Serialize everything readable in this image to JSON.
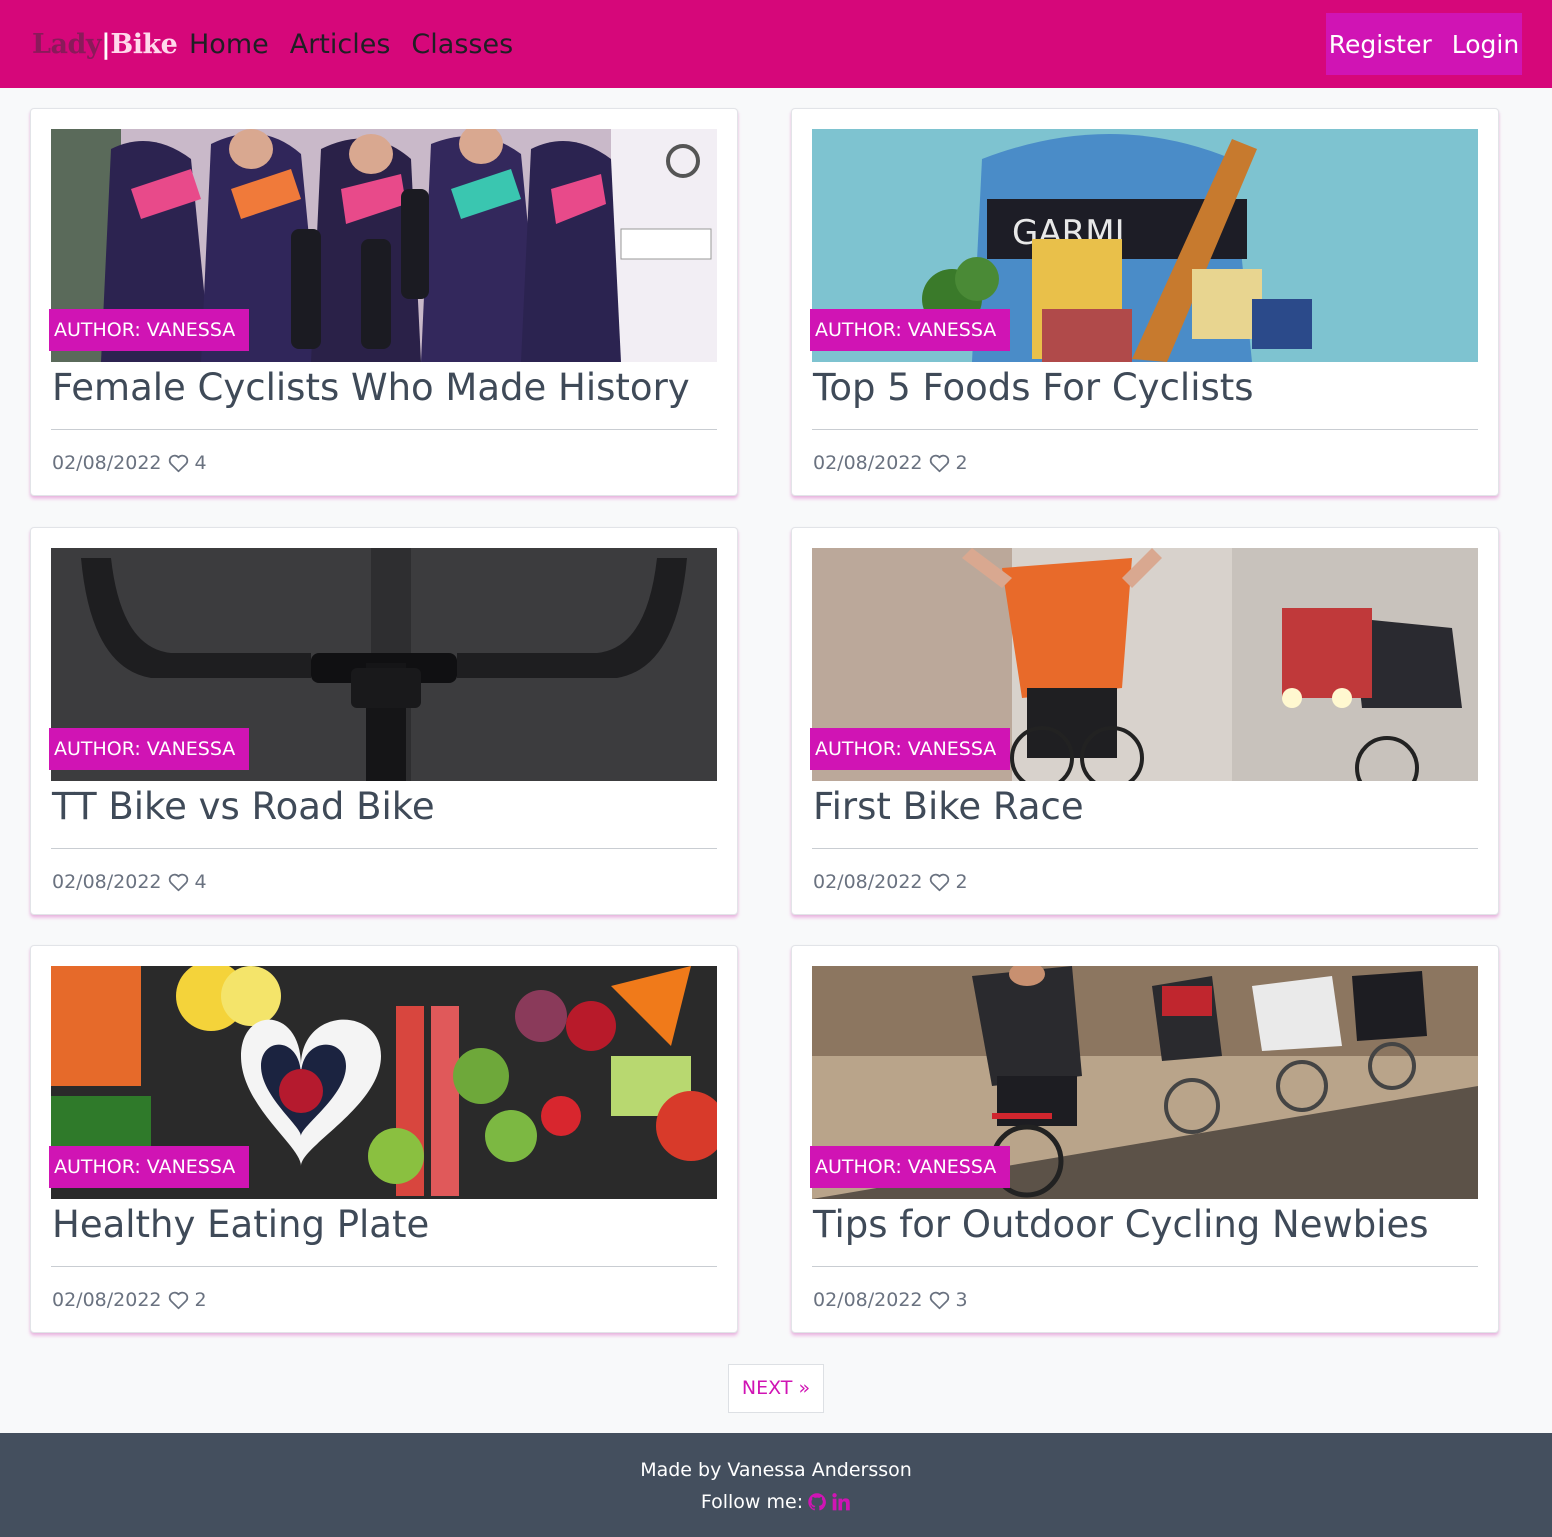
{
  "navbar": {
    "brand_part1": "Lady",
    "brand_sep": "|",
    "brand_part2": "Bike",
    "links": [
      "Home",
      "Articles",
      "Classes"
    ],
    "register": "Register",
    "login": "Login",
    "colors": {
      "navbar_bg": "#d6077a",
      "auth_bg": "#d014b4"
    }
  },
  "articles": [
    {
      "title": "Female Cyclists Who Made History",
      "author": "AUTHOR: VANESSA",
      "date": "02/08/2022",
      "likes": "4",
      "image": "team-of-women-cyclists-celebrating-with-bottles"
    },
    {
      "title": "Top 5 Foods For Cyclists",
      "author": "AUTHOR: VANESSA",
      "date": "02/08/2022",
      "likes": "2",
      "image": "cyclist-with-groceries-bread-pasta"
    },
    {
      "title": "TT Bike vs Road Bike",
      "author": "AUTHOR: VANESSA",
      "date": "02/08/2022",
      "likes": "4",
      "image": "bike-handlebar-closeup"
    },
    {
      "title": "First Bike Race",
      "author": "AUTHOR: VANESSA",
      "date": "02/08/2022",
      "likes": "2",
      "image": "cyclists-finishing-race"
    },
    {
      "title": "Healthy Eating Plate",
      "author": "AUTHOR: VANESSA",
      "date": "02/08/2022",
      "likes": "2",
      "image": "fruits-and-vegetables-heart-bowl"
    },
    {
      "title": "Tips for Outdoor Cycling Newbies",
      "author": "AUTHOR: VANESSA",
      "date": "02/08/2022",
      "likes": "3",
      "image": "group-of-cyclists-riding-on-road"
    }
  ],
  "pagination": {
    "next": "NEXT »"
  },
  "footer": {
    "made_by": "Made by Vanessa Andersson",
    "follow": "Follow me:",
    "icons": [
      "github-icon",
      "linkedin-icon"
    ],
    "accent": "#d014b4"
  }
}
